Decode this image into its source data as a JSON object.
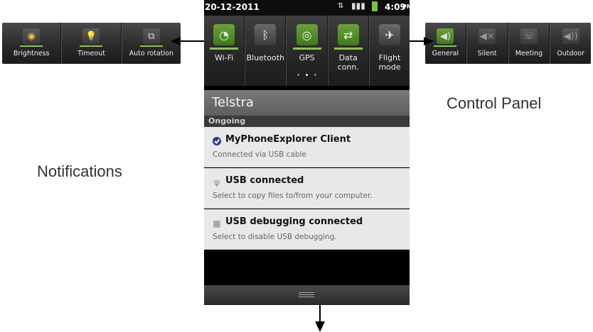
{
  "status_bar": {
    "date": "20-12-2011",
    "time": "4:09",
    "ampm": "PM",
    "icons": [
      "data-transfer-icon",
      "signal-3g-icon",
      "battery-charging-icon"
    ]
  },
  "quick_settings": [
    {
      "label": "Wi-Fi",
      "icon": "wifi-icon",
      "on": true
    },
    {
      "label": "Bluetooth",
      "icon": "bluetooth-icon",
      "on": false
    },
    {
      "label": "GPS",
      "icon": "gps-icon",
      "on": true
    },
    {
      "label": "Data\nconn.",
      "icon": "data-connection-icon",
      "on": true
    },
    {
      "label": "Flight\nmode",
      "icon": "airplane-icon",
      "on": false
    }
  ],
  "page_indicator": {
    "pages": 3,
    "current": 2
  },
  "carrier": "Telstra",
  "section_header": "Ongoing",
  "notifications": [
    {
      "title": "MyPhoneExplorer Client",
      "subtitle": "Connected via USB cable",
      "icon": "myphoneexplorer-icon"
    },
    {
      "title": "USB connected",
      "subtitle": "Select to copy files to/from your computer.",
      "icon": "usb-icon"
    },
    {
      "title": "USB debugging connected",
      "subtitle": "Select to disable USB debugging.",
      "icon": "android-debug-icon"
    }
  ],
  "left_panel": {
    "items": [
      {
        "label": "Brightness",
        "icon": "brightness-icon"
      },
      {
        "label": "Timeout",
        "icon": "timeout-bulb-icon"
      },
      {
        "label": "Auto rotation",
        "icon": "auto-rotation-icon"
      }
    ]
  },
  "right_panel": {
    "items": [
      {
        "label": "General",
        "icon": "sound-general-icon",
        "active": true
      },
      {
        "label": "Silent",
        "icon": "sound-silent-icon",
        "active": false
      },
      {
        "label": "Meeting",
        "icon": "sound-meeting-icon",
        "active": false
      },
      {
        "label": "Outdoor",
        "icon": "sound-outdoor-icon",
        "active": false
      }
    ]
  },
  "annotations": {
    "control_panel": "Control Panel",
    "notifications": "Notifications"
  },
  "colors": {
    "accent_green": "#8bc34a",
    "panel_dark": "#2a2a2a",
    "notification_bg": "#e8e8e8"
  }
}
